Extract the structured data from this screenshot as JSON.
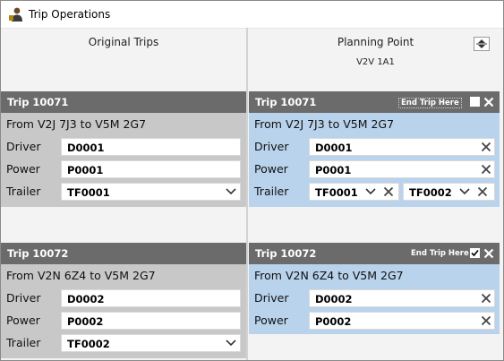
{
  "window": {
    "title": "Trip Operations"
  },
  "columns": {
    "left_title": "Original Trips",
    "right_title": "Planning Point",
    "right_subtitle": "V2V 1A1"
  },
  "original_trips": [
    {
      "header": "Trip 10071",
      "route": "From V2J 7J3 to V5M 2G7",
      "labels": {
        "driver": "Driver",
        "power": "Power",
        "trailer": "Trailer"
      },
      "driver": "D0001",
      "power": "P0001",
      "trailer": "TF0001"
    },
    {
      "header": "Trip 10072",
      "route": "From V2N 6Z4 to V5M 2G7",
      "labels": {
        "driver": "Driver",
        "power": "Power",
        "trailer": "Trailer"
      },
      "driver": "D0002",
      "power": "P0002",
      "trailer": "TF0002"
    }
  ],
  "planned_trips": [
    {
      "header": "Trip 10071",
      "end_trip_label": "End Trip Here",
      "end_trip_checked": false,
      "route": "From V2J 7J3 to V5M 2G7",
      "labels": {
        "driver": "Driver",
        "power": "Power",
        "trailer": "Trailer"
      },
      "driver": "D0001",
      "power": "P0001",
      "trailers": [
        "TF0001",
        "TF0002"
      ]
    },
    {
      "header": "Trip 10072",
      "end_trip_label": "End Trip Here",
      "end_trip_checked": true,
      "route": "From V2N 6Z4 to V5M 2G7",
      "labels": {
        "driver": "Driver",
        "power": "Power"
      },
      "driver": "D0002",
      "power": "P0002"
    }
  ],
  "colors": {
    "header_bg": "#6b6b6b",
    "original_body_bg": "#c8c8c8",
    "planned_body_bg": "#b9d3ec",
    "window_bg": "#f3f3f3"
  }
}
